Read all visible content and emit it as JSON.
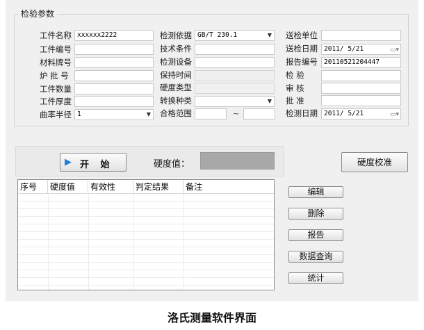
{
  "group_title": "检验参数",
  "col1": [
    {
      "label": "工件名称",
      "value": "xxxxxx2222"
    },
    {
      "label": "工件编号",
      "value": ""
    },
    {
      "label": "材料牌号",
      "value": ""
    },
    {
      "label": "炉 批 号",
      "value": ""
    },
    {
      "label": "工件数量",
      "value": ""
    },
    {
      "label": "工件厚度",
      "value": ""
    },
    {
      "label": "曲率半径",
      "value": "1"
    }
  ],
  "col2": [
    {
      "label": "检测依据",
      "value": "GB/T 230.1"
    },
    {
      "label": "技术条件",
      "value": ""
    },
    {
      "label": "检测设备",
      "value": ""
    },
    {
      "label": "保持时间",
      "value": ""
    },
    {
      "label": "硬度类型",
      "value": ""
    },
    {
      "label": "转换种类",
      "value": ""
    },
    {
      "label": "合格范围",
      "value": "",
      "value2": "",
      "separator": "~"
    }
  ],
  "col3": [
    {
      "label": "送检单位",
      "value": ""
    },
    {
      "label": "送检日期",
      "value": "2011/ 5/21"
    },
    {
      "label": "报告编号",
      "value": "20110521204447"
    },
    {
      "label": "检 验",
      "value": ""
    },
    {
      "label": "审 核",
      "value": ""
    },
    {
      "label": "批 准",
      "value": ""
    },
    {
      "label": "检测日期",
      "value": "2011/ 5/21"
    }
  ],
  "start_button": "开 始",
  "hardness_label": "硬度值：",
  "hardness_value": "",
  "calibrate_button": "硬度校准",
  "table": {
    "headers": [
      "序号",
      "硬度值",
      "有效性",
      "判定结果",
      "备注"
    ]
  },
  "side_buttons": [
    "编辑",
    "删除",
    "报告",
    "数据查询",
    "统计"
  ],
  "caption": "洛氏测量软件界面",
  "icons": {
    "play": "play-icon",
    "dropdown": "chevron-down-icon",
    "calendar": "calendar-icon"
  },
  "colors": {
    "accent": "#1e7fd6",
    "hardness_box": "#a8a8a8",
    "window_bg": "#f0f0f0"
  }
}
